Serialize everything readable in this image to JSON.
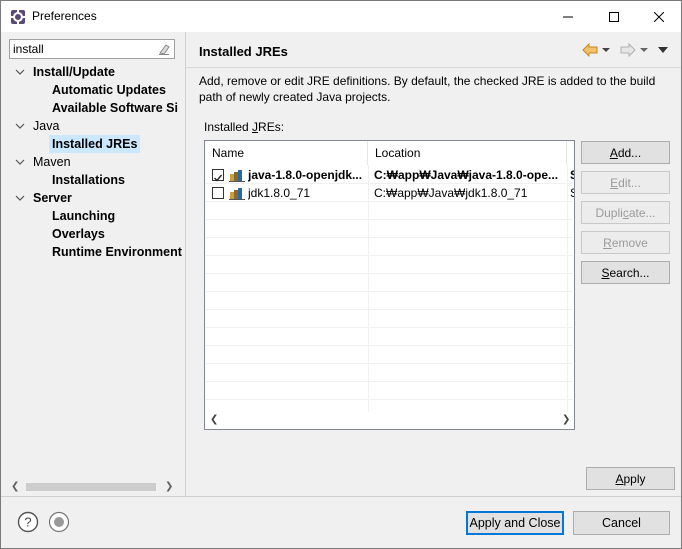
{
  "window": {
    "title": "Preferences"
  },
  "filter": {
    "value": "install"
  },
  "tree": [
    {
      "label": "Install/Update",
      "bold": true,
      "level": 0,
      "expanded": true
    },
    {
      "label": "Automatic Updates",
      "bold": true,
      "level": 1
    },
    {
      "label": "Available Software Si",
      "bold": true,
      "level": 1
    },
    {
      "label": "Java",
      "bold": false,
      "level": 0,
      "expanded": true
    },
    {
      "label": "Installed JREs",
      "bold": true,
      "level": 1,
      "selected": true
    },
    {
      "label": "Maven",
      "bold": false,
      "level": 0,
      "expanded": true
    },
    {
      "label": "Installations",
      "bold": true,
      "level": 1
    },
    {
      "label": "Server",
      "bold": true,
      "level": 0,
      "expanded": true
    },
    {
      "label": "Launching",
      "bold": true,
      "level": 1
    },
    {
      "label": "Overlays",
      "bold": true,
      "level": 1
    },
    {
      "label": "Runtime Environment",
      "bold": true,
      "level": 1
    }
  ],
  "page": {
    "title": "Installed JREs",
    "description": "Add, remove or edit JRE definitions. By default, the checked JRE is added to the build path of newly created Java projects.",
    "table_label_pre": "Installed ",
    "table_label_ul": "J",
    "table_label_post": "REs:"
  },
  "table": {
    "columns": [
      "Name",
      "Location",
      "T"
    ],
    "rows": [
      {
        "checked": true,
        "bold": true,
        "name": "java-1.8.0-openjdk...",
        "location": "C:₩app₩Java₩java-1.8.0-ope...",
        "type": "S"
      },
      {
        "checked": false,
        "bold": false,
        "name": "jdk1.8.0_71",
        "location": "C:₩app₩Java₩jdk1.8.0_71",
        "type": "S"
      }
    ]
  },
  "buttons": {
    "add": {
      "pre": "",
      "ul": "A",
      "post": "dd...",
      "enabled": true
    },
    "edit": {
      "pre": "",
      "ul": "E",
      "post": "dit...",
      "enabled": false
    },
    "duplicate": {
      "pre": "Dupli",
      "ul": "c",
      "post": "ate...",
      "enabled": false
    },
    "remove": {
      "pre": "",
      "ul": "R",
      "post": "emove",
      "enabled": false
    },
    "search": {
      "pre": "",
      "ul": "S",
      "post": "earch...",
      "enabled": true
    },
    "apply": {
      "pre": "",
      "ul": "A",
      "post": "pply"
    },
    "apply_close": "Apply and Close",
    "cancel": "Cancel"
  },
  "icons": {
    "app": "eclipse-preferences-icon",
    "filter_clear": "eraser-icon",
    "back": "back-arrow-icon",
    "forward": "forward-arrow-icon",
    "menu": "view-menu-icon",
    "jre": "jre-library-icon",
    "help": "help-icon",
    "import_export": "import-export-icon"
  },
  "colors": {
    "selection": "#cce8ff",
    "default_button_border": "#0078d7",
    "back_arrow": "#e8a33a"
  }
}
